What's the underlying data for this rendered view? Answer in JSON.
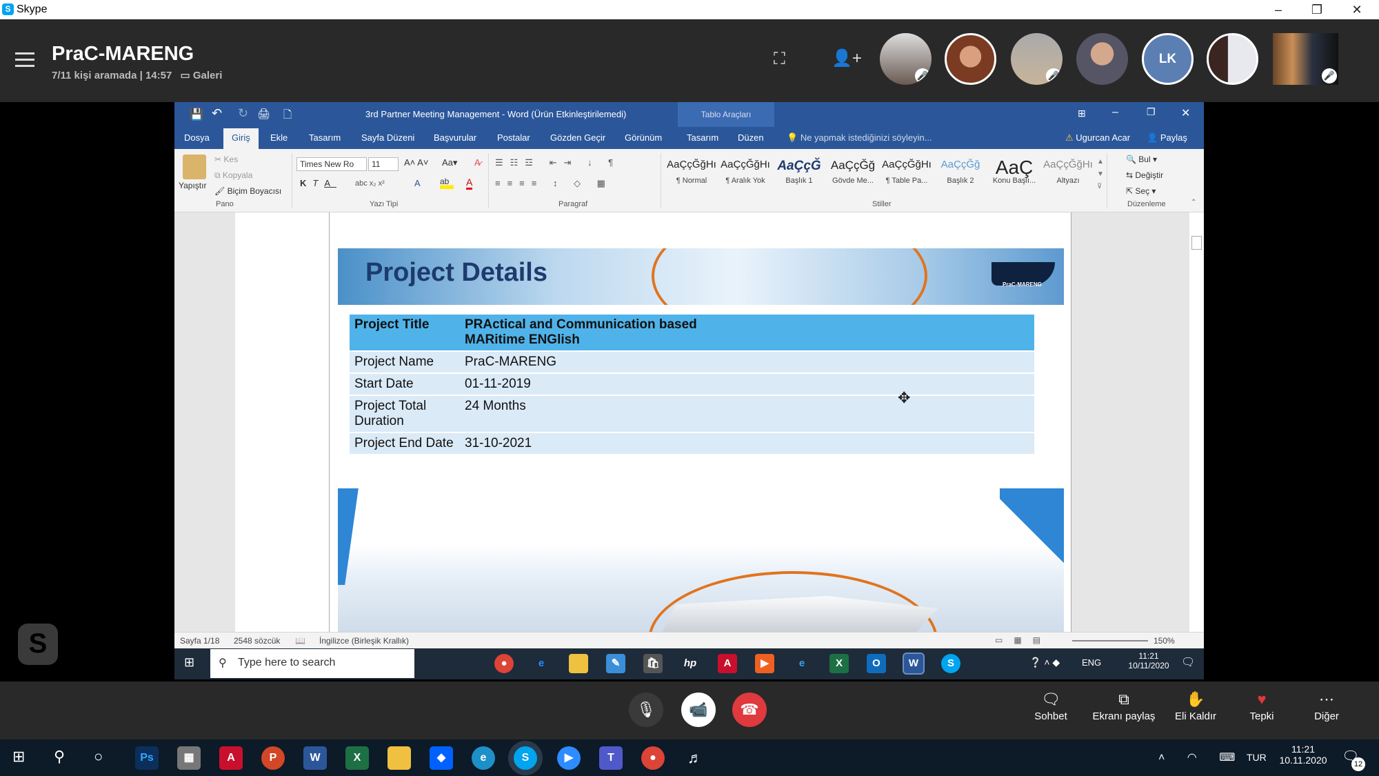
{
  "window": {
    "app_title": "Skype"
  },
  "call": {
    "title": "PraC-MARENG",
    "subtitle": "7/11 kişi aramada | 14:57",
    "view_mode": "Galeri",
    "participant_initials": "LK"
  },
  "word": {
    "doc_title": "3rd Partner Meeting Management - Word (Ürün Etkinleştirilemedi)",
    "tools_label": "Tablo Araçları",
    "tabs": [
      "Dosya",
      "Giriş",
      "Ekle",
      "Tasarım",
      "Sayfa Düzeni",
      "Başvurular",
      "Postalar",
      "Gözden Geçir",
      "Görünüm",
      "Tasarım",
      "Düzen"
    ],
    "tell_me": "Ne yapmak istediğinizi söyleyin...",
    "user": "Ugurcan Acar",
    "share": "Paylaş",
    "clipboard": {
      "paste": "Yapıştır",
      "cut": "Kes",
      "copy": "Kopyala",
      "format_painter": "Biçim Boyacısı",
      "group": "Pano"
    },
    "font": {
      "name": "Times New Ro",
      "size": "11",
      "group": "Yazı Tipi"
    },
    "paragraph_group": "Paragraf",
    "styles": [
      {
        "preview": "AaÇçĞğHı",
        "name": "¶ Normal"
      },
      {
        "preview": "AaÇçĞğHı",
        "name": "¶ Aralık Yok"
      },
      {
        "preview": "AaÇçĞ",
        "name": "Başlık 1"
      },
      {
        "preview": "AaÇçĞğ",
        "name": "Gövde Me..."
      },
      {
        "preview": "AaÇçĞğHı",
        "name": "¶ Table Pa..."
      },
      {
        "preview": "AaÇçĞğ",
        "name": "Başlık 2"
      },
      {
        "preview": "AaÇ",
        "name": "Konu Başlı..."
      },
      {
        "preview": "AaÇçĞğHı",
        "name": "Altyazı"
      }
    ],
    "styles_group": "Stiller",
    "editing": {
      "find": "Bul",
      "replace": "Değiştir",
      "select": "Seç",
      "group": "Düzenleme"
    },
    "status": {
      "page": "Sayfa 1/18",
      "words": "2548 sözcük",
      "language": "İngilizce (Birleşik Krallık)",
      "zoom": "150%"
    }
  },
  "document": {
    "heading": "Project Details",
    "logo_text": "PraC-MARENG",
    "table": [
      {
        "key": "Project Title",
        "value": "PRActical and Communication based MARitime ENGlish"
      },
      {
        "key": "Project Name",
        "value": "PraC-MARENG"
      },
      {
        "key": "Start Date",
        "value": "01-11-2019"
      },
      {
        "key": "Project Total Duration",
        "value": "24 Months"
      },
      {
        "key": "Project End Date",
        "value": "31-10-2021"
      }
    ]
  },
  "inner_taskbar": {
    "search_placeholder": "Type here to search",
    "lang": "ENG",
    "time": "11:21",
    "date": "10/11/2020"
  },
  "callbar": {
    "actions": [
      "Sohbet",
      "Ekranı paylaş",
      "Eli Kaldır",
      "Tepki",
      "Diğer"
    ]
  },
  "taskbar": {
    "lang": "TUR",
    "time": "11:21",
    "date": "10.11.2020",
    "notifications": "12"
  },
  "colors": {
    "word_blue": "#2b579a",
    "end_call": "#e0393e",
    "table_header": "#4fb3ea"
  }
}
